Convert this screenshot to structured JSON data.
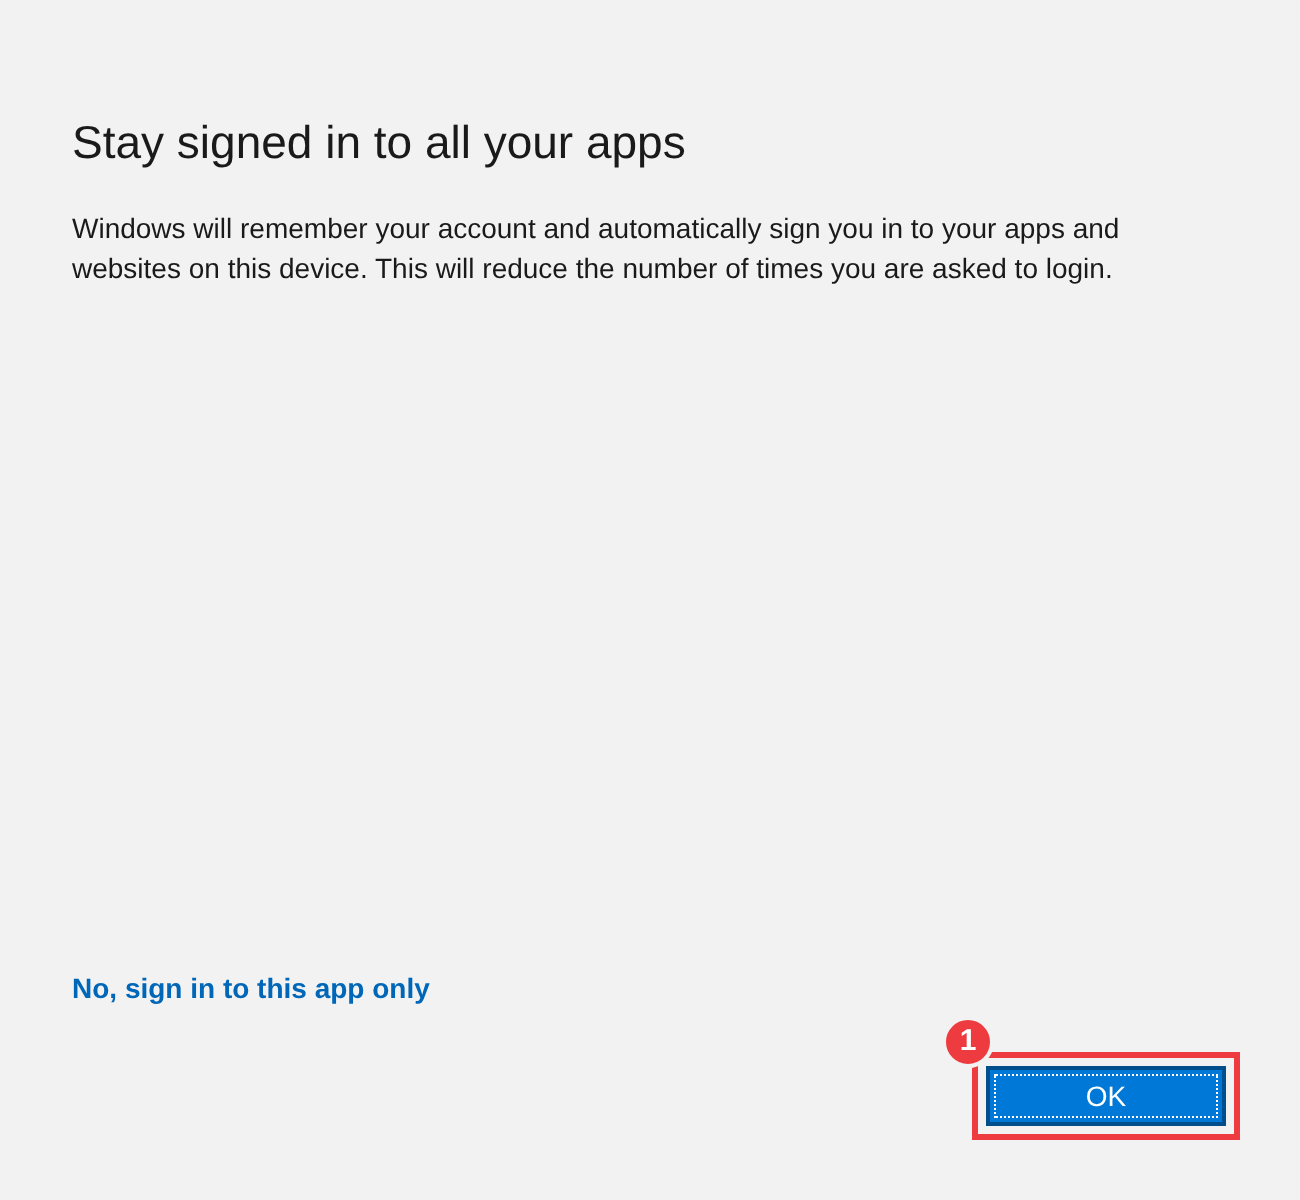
{
  "title": "Stay signed in to all your apps",
  "description": "Windows will remember your account and automatically sign you in to your apps and websites on this device. This will reduce the number of times you are asked to login.",
  "link": "No, sign in to this app only",
  "button": {
    "label": "OK",
    "focused": true
  },
  "annotation": {
    "label": "1"
  }
}
